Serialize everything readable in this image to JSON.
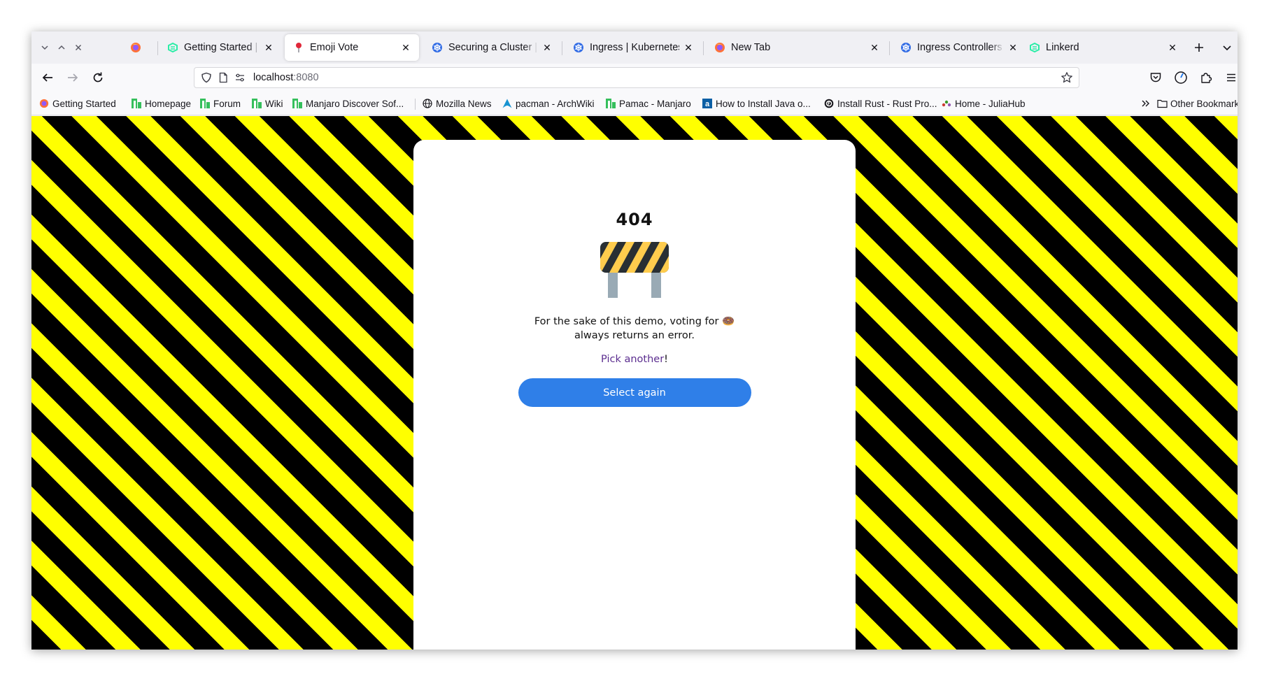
{
  "tabs": [
    {
      "title": "",
      "icon": "firefox-icon",
      "active": false
    },
    {
      "title": "Getting Started | Linkerd",
      "icon": "linkerd-icon",
      "active": false
    },
    {
      "title": "Emoji Vote",
      "icon": "pin-icon",
      "active": true
    },
    {
      "title": "Securing a Cluster | Kubernetes",
      "icon": "kubernetes-icon",
      "active": false
    },
    {
      "title": "Ingress | Kubernetes",
      "icon": "kubernetes-icon",
      "active": false
    },
    {
      "title": "New Tab",
      "icon": "firefox-icon",
      "active": false
    },
    {
      "title": "Ingress Controllers | Kubernetes",
      "icon": "kubernetes-icon",
      "active": false
    },
    {
      "title": "Linkerd",
      "icon": "linkerd-icon",
      "active": false
    }
  ],
  "urlbar": {
    "host": "localhost",
    "port": ":8080"
  },
  "bookmarks": {
    "items": [
      {
        "label": "Getting Started",
        "icon": "firefox-icon"
      },
      {
        "label": "Homepage",
        "icon": "manjaro-icon"
      },
      {
        "label": "Forum",
        "icon": "manjaro-icon"
      },
      {
        "label": "Wiki",
        "icon": "manjaro-icon"
      },
      {
        "label": "Manjaro Discover Sof...",
        "icon": "manjaro-icon"
      },
      {
        "label": "Mozilla News",
        "icon": "globe-icon"
      },
      {
        "label": "pacman - ArchWiki",
        "icon": "arch-icon"
      },
      {
        "label": "Pamac - Manjaro",
        "icon": "manjaro-icon"
      },
      {
        "label": "How to Install Java o...",
        "icon": "a-icon"
      },
      {
        "label": "Install Rust - Rust Pro...",
        "icon": "rust-icon"
      },
      {
        "label": "Home - JuliaHub",
        "icon": "julia-icon"
      }
    ],
    "other": "Other Bookmarks"
  },
  "page": {
    "code": "404",
    "message_prefix": "For the sake of this demo, voting for",
    "message_emoji": "🍩",
    "message_suffix": "always returns an error.",
    "pick_link": "Pick another",
    "pick_suffix": "!",
    "button": "Select again"
  },
  "colors": {
    "stripe_dark": "#000000",
    "stripe_light": "#ffff00",
    "button": "#2f7fe8",
    "link": "#5b2d8f"
  }
}
